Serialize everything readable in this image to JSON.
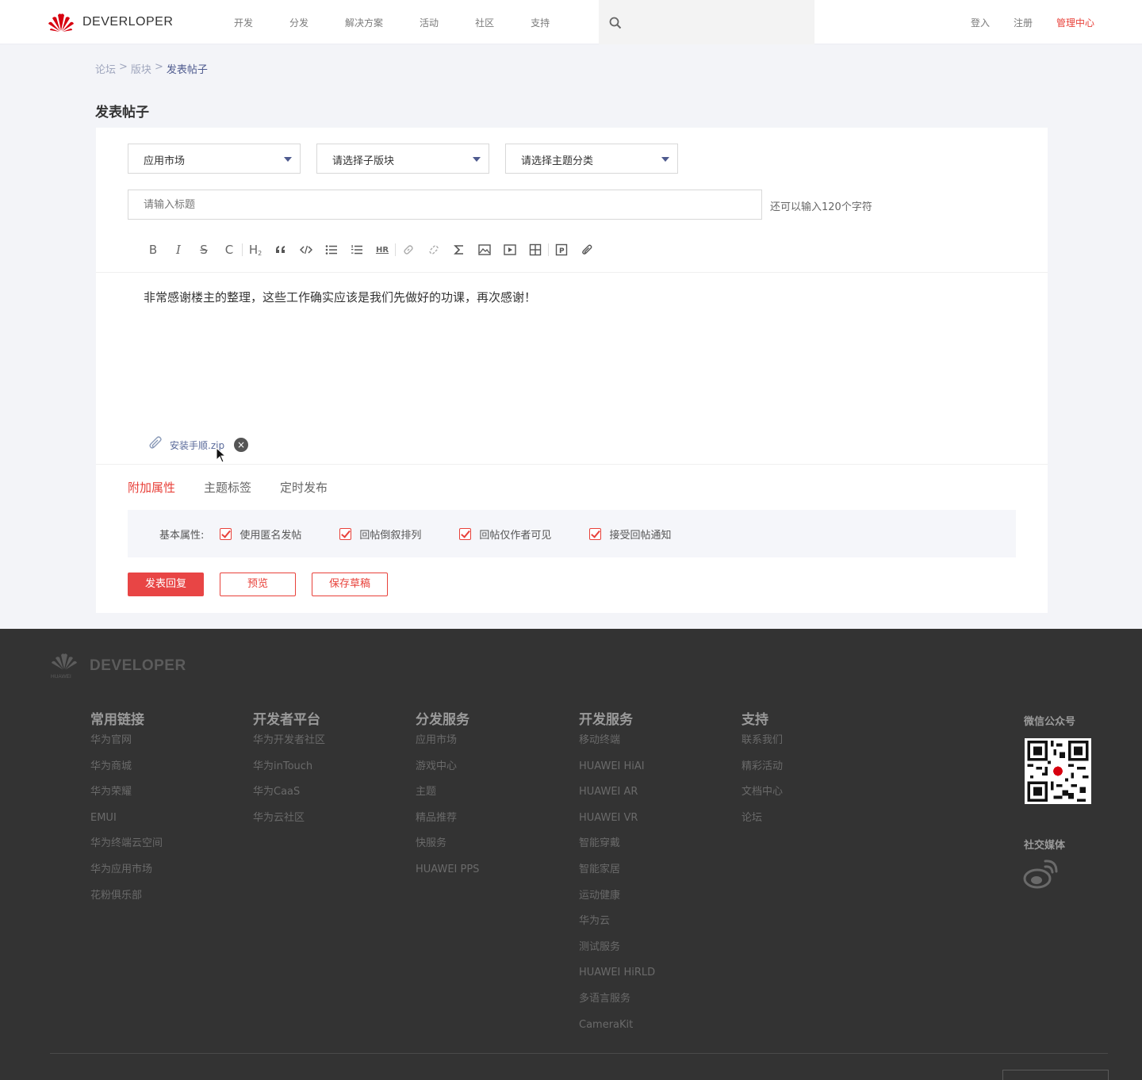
{
  "header": {
    "brand": "DEVERLOPER",
    "nav": [
      "开发",
      "分发",
      "解决方案",
      "活动",
      "社区",
      "支持"
    ],
    "login": "登入",
    "register": "注册",
    "admin": "管理中心",
    "accent_color": "#e8413a"
  },
  "breadcrumb": {
    "items": [
      "论坛",
      "版块"
    ],
    "separator": ">",
    "current": "发表帖子"
  },
  "page_title": "发表帖子",
  "form": {
    "selects": [
      "应用市场",
      "请选择子版块",
      "请选择主题分类"
    ],
    "title_placeholder": "请输入标题",
    "char_hint": "还可以输入120个字符",
    "toolbar_icons": [
      "bold-icon",
      "italic-icon",
      "strikethrough-icon",
      "clear-format-icon",
      "heading-icon",
      "quote-icon",
      "code-icon",
      "bullet-list-icon",
      "numbered-list-icon",
      "horizontal-rule-icon",
      "link-icon",
      "unlink-icon",
      "formula-icon",
      "image-icon",
      "video-icon",
      "table-icon",
      "p-icon",
      "attachment-icon"
    ],
    "toolbar_glyphs": {
      "bold": "B",
      "italic": "I",
      "strike": "S",
      "clear": "C",
      "heading": "H",
      "hr": "HR",
      "p": "P"
    },
    "body_text": "非常感谢楼主的整理，这些工作确实应该是我们先做好的功课，再次感谢！",
    "attachment": {
      "name": "安装手顺.zip",
      "remove_glyph": "×"
    },
    "tabs": [
      "附加属性",
      "主题标签",
      "定时发布"
    ],
    "props_label": "基本属性:",
    "checkboxes": [
      {
        "label": "使用匿名发帖",
        "checked": true
      },
      {
        "label": "回帖倒叙排列",
        "checked": true
      },
      {
        "label": "回帖仅作者可见",
        "checked": true
      },
      {
        "label": "接受回帖通知",
        "checked": true
      }
    ],
    "buttons": {
      "submit": "发表回复",
      "preview": "预览",
      "save_draft": "保存草稿"
    }
  },
  "footer": {
    "brand": "DEVELOPER",
    "logo_sub": "HUAWEI",
    "columns": [
      {
        "title": "常用链接",
        "links": [
          "华为官网",
          "华为商城",
          "华为荣耀",
          "EMUI",
          "华为终端云空间",
          "华为应用市场",
          "花粉俱乐部"
        ]
      },
      {
        "title": "开发者平台",
        "links": [
          "华为开发者社区",
          "华为inTouch",
          "华为CaaS",
          "华为云社区"
        ]
      },
      {
        "title": "分发服务",
        "links": [
          "应用市场",
          "游戏中心",
          "主题",
          "精品推荐",
          "快服务",
          "HUAWEI PPS"
        ]
      },
      {
        "title": "开发服务",
        "links": [
          "移动终端",
          "HUAWEI HiAI",
          "HUAWEI AR",
          "HUAWEI VR",
          "智能穿戴",
          "智能家居",
          "运动健康",
          "华为云",
          "测试服务",
          "HUAWEI HiRLD",
          "多语言服务",
          "CameraKit"
        ]
      },
      {
        "title": "支持",
        "links": [
          "联系我们",
          "精彩活动",
          "文档中心",
          "论坛"
        ]
      }
    ],
    "wechat_label": "微信公众号",
    "social_label": "社交媒体"
  }
}
